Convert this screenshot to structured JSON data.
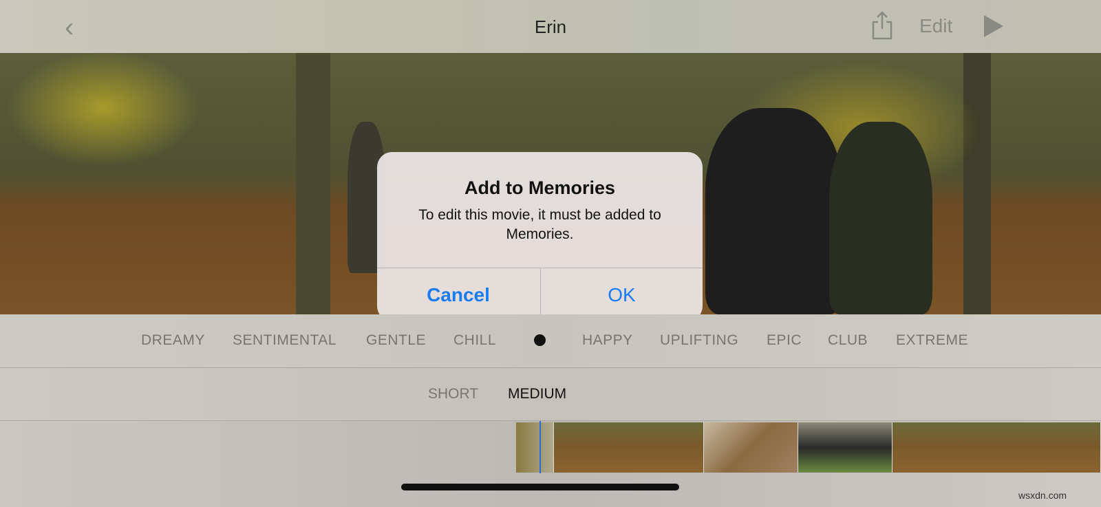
{
  "header": {
    "title": "Erin",
    "back_icon": "chevron-left-icon",
    "share_icon": "share-icon",
    "edit_label": "Edit",
    "play_icon": "play-icon"
  },
  "dialog": {
    "title": "Add to Memories",
    "message": "To edit this movie, it must be added to Memories.",
    "cancel_label": "Cancel",
    "ok_label": "OK",
    "button_color": "#1a7cf0"
  },
  "moods": {
    "items": [
      "DREAMY",
      "SENTIMENTAL",
      "GENTLE",
      "CHILL",
      "HAPPY",
      "UPLIFTING",
      "EPIC",
      "CLUB",
      "EXTREME"
    ],
    "selected_indicator": "dot"
  },
  "lengths": {
    "items": [
      "SHORT",
      "MEDIUM"
    ],
    "selected": "MEDIUM"
  },
  "watermark": "wsxdn.com"
}
